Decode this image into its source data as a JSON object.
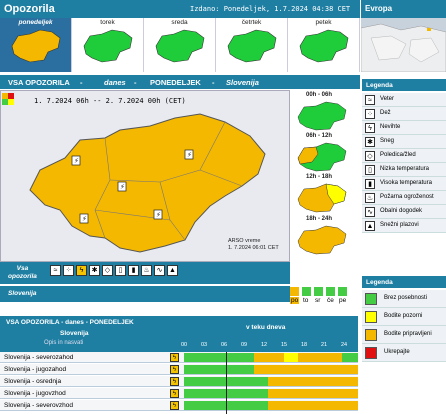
{
  "header": {
    "title": "Opozorila",
    "issued": "Izdano: Ponedeljek, 1.7.2024 04:38 CET",
    "europe": "Evropa"
  },
  "days": [
    {
      "label": "ponedeljek",
      "active": true,
      "color": "#f5b800"
    },
    {
      "label": "torek",
      "active": false,
      "color": "#1fcc3a"
    },
    {
      "label": "sreda",
      "active": false,
      "color": "#1fcc3a"
    },
    {
      "label": "četrtek",
      "active": false,
      "color": "#1fcc3a"
    },
    {
      "label": "petek",
      "active": false,
      "color": "#1fcc3a"
    }
  ],
  "main": {
    "h1": "VSA OPOZORILA",
    "sep1": "-",
    "h2": "danes",
    "sep2": "-",
    "h3": "PONEDELJEK",
    "sep3": "-",
    "h4": "Slovenija",
    "date_range": "1. 7.2024 06h  --  2. 7.2024 00h  (CET)",
    "arso_line1": "ARSO vreme",
    "arso_line2": "1. 7.2024  06:01 CET"
  },
  "slots": [
    {
      "label": "00h - 06h"
    },
    {
      "label": "06h - 12h"
    },
    {
      "label": "12h - 18h"
    },
    {
      "label": "18h - 24h"
    }
  ],
  "legend": {
    "title": "Legenda",
    "items": [
      "Veter",
      "Dež",
      "Nevihte",
      "Sneg",
      "Poledica/žled",
      "Nizka temperatura",
      "Visoka temperatura",
      "Požarna ogroženost",
      "Obalni dogodek",
      "Snežni plazovi"
    ],
    "title2": "Legenda",
    "levels": [
      {
        "label": "Brez posebnosti",
        "color": "#44cc44"
      },
      {
        "label": "Bodite pozorni",
        "color": "#ffff00"
      },
      {
        "label": "Bodite pripravljeni",
        "color": "#f5b800"
      },
      {
        "label": "Ukrepajte",
        "color": "#e01010"
      }
    ]
  },
  "vsa_row": {
    "label1": "Vsa",
    "label2": "opozorila"
  },
  "slo_row": {
    "label": "Slovenija",
    "days": [
      "po",
      "to",
      "sr",
      "če",
      "pe"
    ]
  },
  "table": {
    "title": "VSA OPOZORILA - danes - PONEDELJEK",
    "col_region": "Slovenija",
    "col_desc": "Opis in nasvati",
    "col_time": "v teku dneva",
    "hours": [
      "00",
      "03",
      "06",
      "09",
      "12",
      "15",
      "18",
      "21",
      "24"
    ],
    "rows": [
      {
        "name": "Slovenija - severozahod"
      },
      {
        "name": "Slovenija - jugozahod"
      },
      {
        "name": "Slovenija - osrednja"
      },
      {
        "name": "Slovenija - jugovzhod"
      },
      {
        "name": "Slovenija - severovzhod"
      }
    ]
  }
}
